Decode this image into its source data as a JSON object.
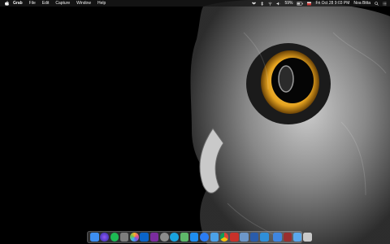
{
  "menubar": {
    "app_name": "Grab",
    "menus": [
      "File",
      "Edit",
      "Capture",
      "Window",
      "Help"
    ],
    "battery": "59%",
    "clock": "Fri Oct 28 9:03 PM",
    "user": "Noa Bitta"
  },
  "wallpaper": {
    "subject": "owl-eye"
  },
  "dock": {
    "apps": [
      {
        "icon": "finder-icon",
        "color": "#3d8ef0"
      },
      {
        "icon": "siri-icon",
        "color": "#4a3ccf"
      },
      {
        "icon": "spotify-icon",
        "color": "#1db954"
      },
      {
        "icon": "activity-monitor-icon",
        "color": "#7d7d7d"
      },
      {
        "icon": "photos-icon",
        "color": "#e44f8e"
      },
      {
        "icon": "outlook-icon",
        "color": "#0a64c8"
      },
      {
        "icon": "onenote-icon",
        "color": "#7a2c9e"
      },
      {
        "icon": "settings-icon",
        "color": "#8c8c8c"
      },
      {
        "icon": "skype-icon",
        "color": "#19a3e0"
      },
      {
        "icon": "maps-icon",
        "color": "#5fb86a"
      },
      {
        "icon": "xcode-icon",
        "color": "#1f8ef0"
      },
      {
        "icon": "app-store-icon",
        "color": "#2b7cf2"
      },
      {
        "icon": "folder-icon",
        "color": "#4ba1e8"
      },
      {
        "icon": "chrome-icon",
        "color": "#e8c23a"
      },
      {
        "icon": "flash-icon",
        "color": "#c8312a"
      },
      {
        "icon": "preview-icon",
        "color": "#6d97c9"
      },
      {
        "icon": "word-icon",
        "color": "#2a5caa"
      },
      {
        "icon": "vs-code-icon",
        "color": "#2f8fd8"
      }
    ],
    "tray": [
      {
        "icon": "downloads-icon",
        "color": "#3f86e0"
      },
      {
        "icon": "stack-icon",
        "color": "#9a2f2f"
      },
      {
        "icon": "documents-folder-icon",
        "color": "#5aa8ec"
      },
      {
        "icon": "trash-icon",
        "color": "#c9c9c9"
      }
    ]
  }
}
